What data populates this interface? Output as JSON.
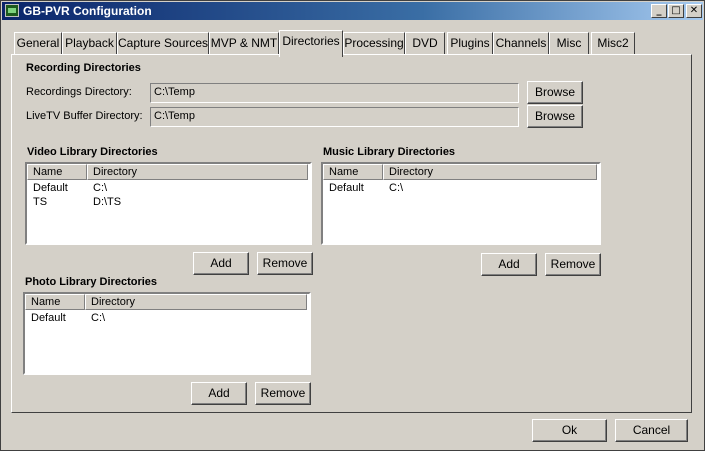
{
  "window": {
    "title": "GB-PVR Configuration"
  },
  "tabs": [
    "General",
    "Playback",
    "Capture Sources",
    "MVP & NMT",
    "Directories",
    "Processing",
    "DVD",
    "Plugins",
    "Channels",
    "Misc",
    "Misc2"
  ],
  "active_tab": "Directories",
  "recording": {
    "heading": "Recording Directories",
    "recordings_label": "Recordings Directory:",
    "recordings_value": "C:\\Temp",
    "livetv_label": "LiveTV Buffer Directory:",
    "livetv_value": "C:\\Temp",
    "browse_label": "Browse"
  },
  "video_library": {
    "heading": "Video Library Directories",
    "columns": [
      "Name",
      "Directory"
    ],
    "rows": [
      [
        "Default",
        "C:\\"
      ],
      [
        "TS",
        "D:\\TS"
      ]
    ]
  },
  "music_library": {
    "heading": "Music Library Directories",
    "columns": [
      "Name",
      "Directory"
    ],
    "rows": [
      [
        "Default",
        "C:\\"
      ]
    ]
  },
  "photo_library": {
    "heading": "Photo Library Directories",
    "columns": [
      "Name",
      "Directory"
    ],
    "rows": [
      [
        "Default",
        "C:\\"
      ]
    ]
  },
  "buttons": {
    "add": "Add",
    "remove": "Remove",
    "ok": "Ok",
    "cancel": "Cancel"
  },
  "title_buttons": {
    "minimize": "_",
    "maximize": "□",
    "close": "✕"
  }
}
